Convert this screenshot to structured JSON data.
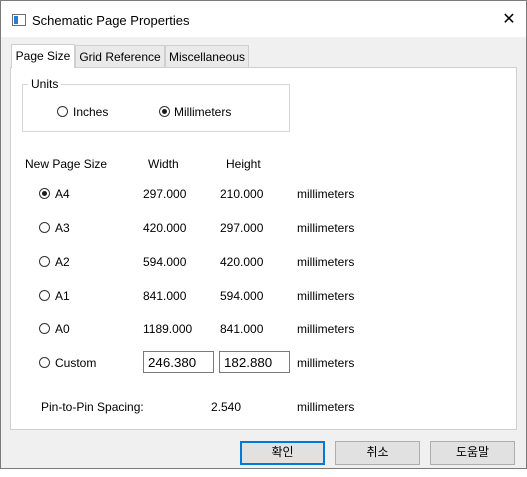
{
  "window": {
    "title": "Schematic Page Properties",
    "close_glyph": "✕"
  },
  "tabs": [
    {
      "label": "Page Size"
    },
    {
      "label": "Grid Reference"
    },
    {
      "label": "Miscellaneous"
    }
  ],
  "units": {
    "group_label": "Units",
    "options": [
      {
        "label": "Inches",
        "checked": false
      },
      {
        "label": "Millimeters",
        "checked": true
      }
    ]
  },
  "size_table": {
    "headers": {
      "new_page_size": "New Page Size",
      "width": "Width",
      "height": "Height"
    },
    "rows": [
      {
        "label": "A4",
        "width": "297.000",
        "height": "210.000",
        "unit": "millimeters",
        "checked": true
      },
      {
        "label": "A3",
        "width": "420.000",
        "height": "297.000",
        "unit": "millimeters",
        "checked": false
      },
      {
        "label": "A2",
        "width": "594.000",
        "height": "420.000",
        "unit": "millimeters",
        "checked": false
      },
      {
        "label": "A1",
        "width": "841.000",
        "height": "594.000",
        "unit": "millimeters",
        "checked": false
      },
      {
        "label": "A0",
        "width": "1189.000",
        "height": "841.000",
        "unit": "millimeters",
        "checked": false
      }
    ],
    "custom": {
      "label": "Custom",
      "width": "246.380",
      "height": "182.880",
      "unit": "millimeters",
      "checked": false
    }
  },
  "pin_spacing": {
    "label": "Pin-to-Pin Spacing:",
    "value": "2.540",
    "unit": "millimeters"
  },
  "buttons": {
    "ok": "확인",
    "cancel": "취소",
    "help": "도움말"
  }
}
